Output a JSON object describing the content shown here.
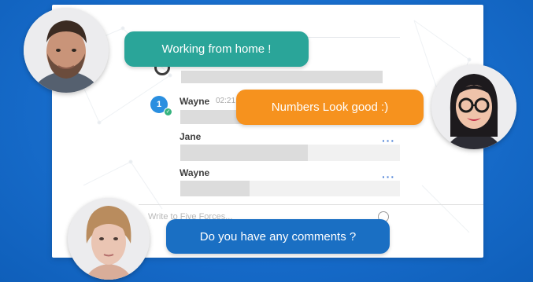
{
  "chat": {
    "messages": [
      {
        "sender": "Wayne",
        "time": "02:21"
      },
      {
        "sender": "Jane"
      },
      {
        "sender": "Wayne"
      }
    ],
    "unread_count": "1",
    "input_placeholder": "Write to Five Forces..."
  },
  "bubbles": {
    "green_text": "Working from home !",
    "orange_text": "Numbers Look good :)",
    "blue_text": "Do you have any comments ?"
  },
  "avatars": [
    {
      "name": "man-avatar",
      "description": "bearded man"
    },
    {
      "name": "woman-glasses-avatar",
      "description": "woman with glasses"
    },
    {
      "name": "woman-blonde-avatar",
      "description": "woman with blonde hair"
    }
  ],
  "colors": {
    "background": "#1469c8",
    "bubble_green": "#2aa599",
    "bubble_orange": "#f6921e",
    "bubble_blue": "#1a6fc3",
    "badge_blue": "#2a8fe0",
    "dots_blue": "#4a7fd6"
  }
}
